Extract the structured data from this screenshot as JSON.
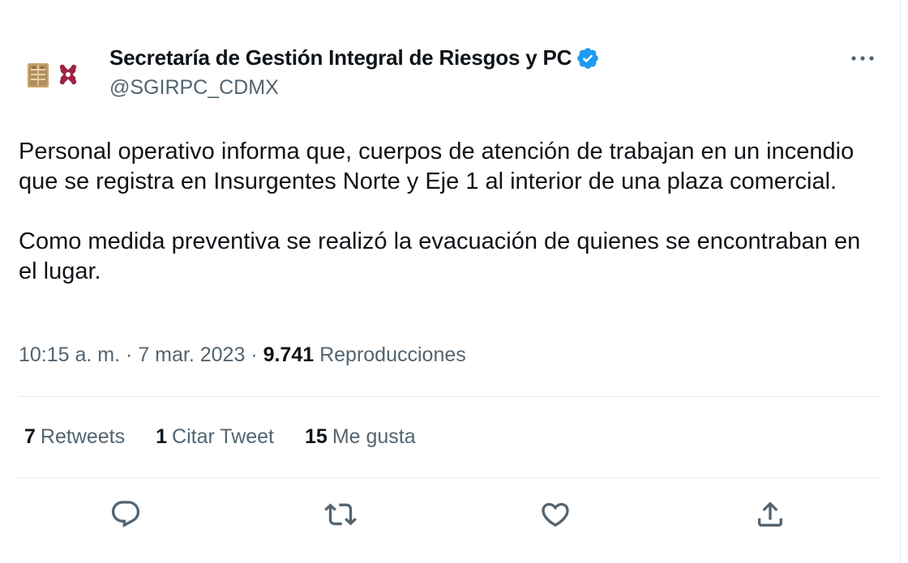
{
  "author": {
    "display_name": "Secretaría de Gestión Integral de Riesgos y PC",
    "handle": "@SGIRPC_CDMX",
    "verified": true,
    "avatar": "cdmx-government-logo"
  },
  "tweet": {
    "paragraphs": [
      "Personal operativo informa que, cuerpos de atención de trabajan en un incendio que se registra en Insurgentes Norte y Eje 1 al interior de una plaza comercial.",
      "Como medida preventiva se realizó la evacuación de quienes se encontraban en el lugar."
    ],
    "time": "10:15 a. m.",
    "separator": "·",
    "date": "7 mar. 2023",
    "views_count": "9.741",
    "views_label": "Reproducciones"
  },
  "stats": {
    "retweets_count": "7",
    "retweets_label": "Retweets",
    "quotes_count": "1",
    "quotes_label": "Citar Tweet",
    "likes_count": "15",
    "likes_label": "Me gusta"
  },
  "actions": {
    "reply": "reply-icon",
    "retweet": "retweet-icon",
    "like": "like-icon",
    "share": "share-icon",
    "more": "more-options-icon"
  },
  "colors": {
    "text_primary": "#0f1419",
    "text_secondary": "#536471",
    "divider": "#e6ebee",
    "verified_blue": "#1d9bf0",
    "logo_gold": "#b38e5d",
    "logo_maroon": "#9f2241"
  }
}
